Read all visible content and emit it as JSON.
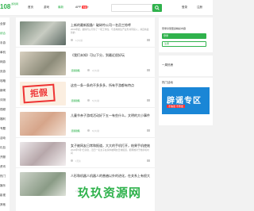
{
  "header": {
    "logo": "108",
    "logo_sub": "游戏网",
    "nav": [
      "首页",
      "游戏",
      "最新",
      "APP"
    ],
    "app_badge": "下载",
    "search_placeholder": "",
    "login": "登录",
    "register": "注册"
  },
  "sidebar": {
    "items": [
      "全部",
      "综合",
      "手游",
      "单机",
      "网游",
      "页游",
      "攻略",
      "新闻",
      "评测",
      "视频",
      "福利",
      "专题",
      "活动",
      "礼包",
      "开服",
      "资讯",
      "热门",
      "娱乐",
      "影视",
      "其他"
    ]
  },
  "articles": [
    {
      "title": "上新的最新报备！破碎符公司一名员工惊呼",
      "summary": "2019年起，破碎符公司为了一项工作性，与当地的生产业务共同投入，并且将最新的",
      "tag": "",
      "meta": "1小时前"
    },
    {
      "title": "《我们未知》可以下分，到最近很好玩",
      "summary": "",
      "tag": "游戏攻略",
      "meta": "3小时前"
    },
    {
      "title": "这些一条一条的不多多多，所有手游都有特点",
      "summary": "",
      "tag": "游戏攻略",
      "meta": "5小时前"
    },
    {
      "title": "儿童节亲子游戏活动好下五一有些什么，文明的大小事件",
      "summary": "",
      "tag": "游戏攻略",
      "meta": "8小时前"
    },
    {
      "title": "女子被网友日常和报道，大大的手机打开，结果手机使她的注意力",
      "summary": "2024年5月7日消息，近日一名女子在家中被网友日常报道，据称她对于她手机时间",
      "tag": "",
      "meta": "1天前"
    },
    {
      "title": "人形和机器人机器人的普遍以外的进化，在关系上有很大的进步",
      "summary": "",
      "tag": "",
      "meta": "1天前"
    }
  ],
  "right": {
    "login_tip": "登录享受更多精彩内容",
    "login_btn": "登录",
    "register_btn": "注册",
    "box1_title": "一周热榜",
    "box2_title": "热门活动",
    "banner_text": "辟谣专区",
    "banner_sub": "不信谣 不传谣"
  },
  "watermark": "玖玖资源网",
  "colors": {
    "accent": "#2fb24c",
    "banner": "#1a86d6"
  }
}
